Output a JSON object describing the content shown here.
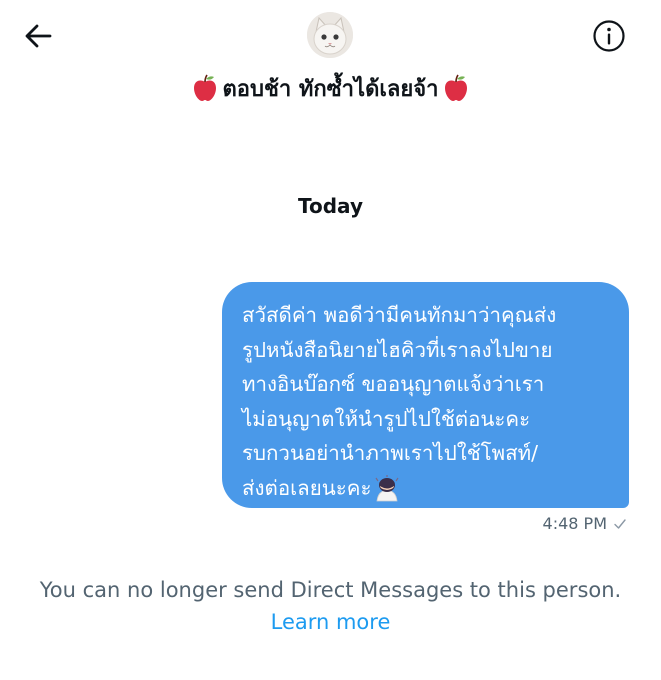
{
  "header": {
    "back_icon": "arrow-left-icon",
    "info_icon": "info-circle-icon",
    "avatar_icon": "cat-avatar",
    "title": "ตอบช้า ทักซ้ำได้เลยจ้า",
    "title_emoji": "red-apple-icon"
  },
  "conversation": {
    "date_separator": "Today",
    "messages": [
      {
        "lines": [
          "สวัสดีค่า พอดีว่ามีคนทักมาว่าคุณส่ง",
          "รูปหนังสือนิยายไฮคิวที่เราลงไปขาย",
          "ทางอินบ๊อกซ์ ขออนุญาตแจ้งว่าเรา",
          "ไม่อนุญาตให้นำรูปไปใช้ต่อนะคะ",
          "รบกวนอย่านำภาพเราไปใช้โพสท์/",
          "ส่งต่อเลยนะคะ"
        ],
        "trailing_emoji": "person-bowing-icon",
        "time": "4:48 PM",
        "status_icon": "checkmark-icon"
      }
    ]
  },
  "footer": {
    "notice": "You can no longer send Direct Messages to this person.",
    "learn_more": "Learn more"
  },
  "colors": {
    "bubble": "#4a99e9",
    "link": "#1d9bf0",
    "muted_text": "#536471",
    "primary_text": "#0f1419"
  }
}
